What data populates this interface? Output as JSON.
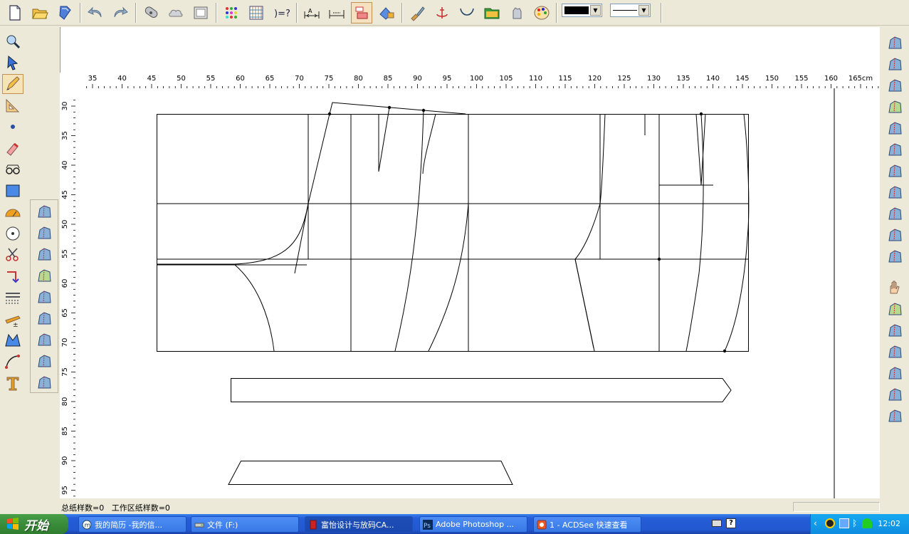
{
  "status": {
    "text": "总纸样数=0   工作区纸样数=0"
  },
  "toolbar": {
    "line_color": "#000000",
    "buttons": [
      "new-file-icon",
      "open-folder-icon",
      "save-icon",
      "undo-icon",
      "redo-icon",
      "measure-tape-icon",
      "cloud-icon",
      "frame-icon",
      "color-dots-icon",
      "grid-icon",
      "formula-icon",
      "dimension-icon",
      "dimension-width-icon",
      "pattern-red-icon",
      "lock-pattern-icon",
      "brush-icon",
      "anchor-icon",
      "curve-icon",
      "folder-icon",
      "hand-stop-icon",
      "palette-icon"
    ]
  },
  "left_toolbar": [
    "zoom-icon",
    "pointer-icon",
    "pencil-icon",
    "ruler-triangle-icon",
    "point-icon",
    "eraser-icon",
    "glasses-icon",
    "rectangle-icon",
    "protractor-icon",
    "circle-icon",
    "scissors-icon",
    "rotate-icon",
    "lines-icon",
    "tracing-icon",
    "dart-icon",
    "curve-edit-icon",
    "text-icon"
  ],
  "left_toolbar2": [
    "select-pattern-icon",
    "flag-pattern-icon",
    "button-icon",
    "measure-icon",
    "pattern-shift-icon",
    "pattern-brush-icon",
    "pattern-cut-icon",
    "pattern-tilt-icon",
    "pattern-align-icon"
  ],
  "right_toolbar": [
    "piece-1-icon",
    "piece-2-icon",
    "piece-3-icon",
    "piece-4-icon",
    "piece-5-icon",
    "piece-6-icon",
    "piece-7-icon",
    "piece-8-icon",
    "piece-9-icon",
    "monitor-icon",
    "help-icon",
    "hand-icon",
    "piece-10-icon",
    "piece-11-icon",
    "piece-12-icon",
    "piece-13-icon",
    "piece-14-icon",
    "axis-icon"
  ],
  "ruler": {
    "top_labels": [
      "35",
      "40",
      "45",
      "50",
      "55",
      "60",
      "65",
      "70",
      "75",
      "80",
      "85",
      "90",
      "95",
      "100",
      "105",
      "110",
      "115",
      "120",
      "125",
      "130",
      "135",
      "140",
      "145",
      "150",
      "155",
      "160",
      "165cm"
    ],
    "left_labels": [
      "30",
      "35",
      "40",
      "45",
      "50",
      "55",
      "60",
      "65",
      "70",
      "75",
      "80",
      "85",
      "90",
      "95"
    ]
  },
  "taskbar": {
    "start_label": "开始",
    "tasks": [
      {
        "label": "我的简历 -我的信...",
        "icon": "browser-icon"
      },
      {
        "label": "文件 (F:)",
        "icon": "drive-icon"
      },
      {
        "label": "富怡设计与放码CA...",
        "icon": "cad-app-icon"
      },
      {
        "label": "Adobe Photoshop ...",
        "icon": "photoshop-icon"
      },
      {
        "label": "1 - ACDSee 快速查看",
        "icon": "acdsee-icon"
      }
    ],
    "clock": "12:02"
  }
}
